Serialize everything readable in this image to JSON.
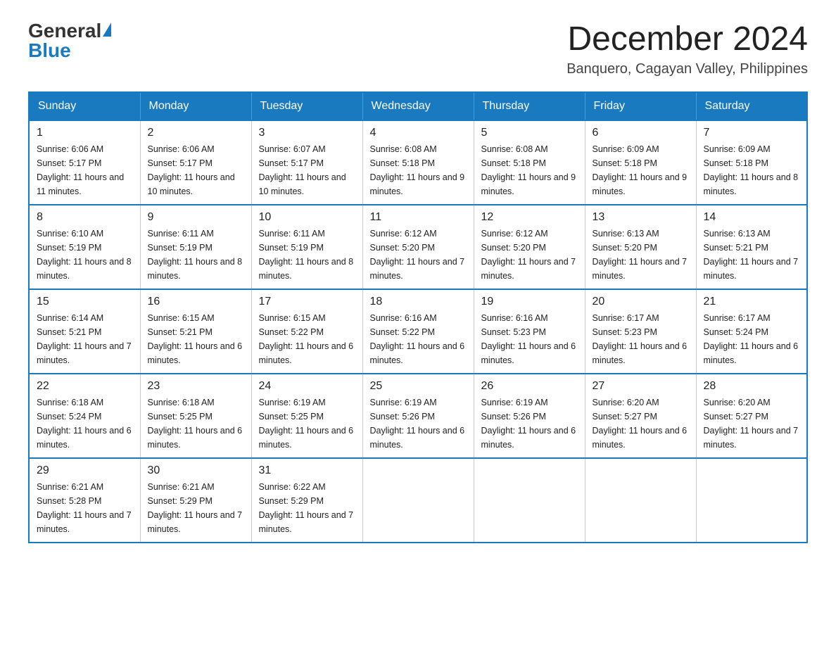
{
  "header": {
    "logo_general": "General",
    "logo_blue": "Blue",
    "month_title": "December 2024",
    "location": "Banquero, Cagayan Valley, Philippines"
  },
  "days_of_week": [
    "Sunday",
    "Monday",
    "Tuesday",
    "Wednesday",
    "Thursday",
    "Friday",
    "Saturday"
  ],
  "weeks": [
    [
      {
        "day": "1",
        "sunrise": "6:06 AM",
        "sunset": "5:17 PM",
        "daylight": "11 hours and 11 minutes."
      },
      {
        "day": "2",
        "sunrise": "6:06 AM",
        "sunset": "5:17 PM",
        "daylight": "11 hours and 10 minutes."
      },
      {
        "day": "3",
        "sunrise": "6:07 AM",
        "sunset": "5:17 PM",
        "daylight": "11 hours and 10 minutes."
      },
      {
        "day": "4",
        "sunrise": "6:08 AM",
        "sunset": "5:18 PM",
        "daylight": "11 hours and 9 minutes."
      },
      {
        "day": "5",
        "sunrise": "6:08 AM",
        "sunset": "5:18 PM",
        "daylight": "11 hours and 9 minutes."
      },
      {
        "day": "6",
        "sunrise": "6:09 AM",
        "sunset": "5:18 PM",
        "daylight": "11 hours and 9 minutes."
      },
      {
        "day": "7",
        "sunrise": "6:09 AM",
        "sunset": "5:18 PM",
        "daylight": "11 hours and 8 minutes."
      }
    ],
    [
      {
        "day": "8",
        "sunrise": "6:10 AM",
        "sunset": "5:19 PM",
        "daylight": "11 hours and 8 minutes."
      },
      {
        "day": "9",
        "sunrise": "6:11 AM",
        "sunset": "5:19 PM",
        "daylight": "11 hours and 8 minutes."
      },
      {
        "day": "10",
        "sunrise": "6:11 AM",
        "sunset": "5:19 PM",
        "daylight": "11 hours and 8 minutes."
      },
      {
        "day": "11",
        "sunrise": "6:12 AM",
        "sunset": "5:20 PM",
        "daylight": "11 hours and 7 minutes."
      },
      {
        "day": "12",
        "sunrise": "6:12 AM",
        "sunset": "5:20 PM",
        "daylight": "11 hours and 7 minutes."
      },
      {
        "day": "13",
        "sunrise": "6:13 AM",
        "sunset": "5:20 PM",
        "daylight": "11 hours and 7 minutes."
      },
      {
        "day": "14",
        "sunrise": "6:13 AM",
        "sunset": "5:21 PM",
        "daylight": "11 hours and 7 minutes."
      }
    ],
    [
      {
        "day": "15",
        "sunrise": "6:14 AM",
        "sunset": "5:21 PM",
        "daylight": "11 hours and 7 minutes."
      },
      {
        "day": "16",
        "sunrise": "6:15 AM",
        "sunset": "5:21 PM",
        "daylight": "11 hours and 6 minutes."
      },
      {
        "day": "17",
        "sunrise": "6:15 AM",
        "sunset": "5:22 PM",
        "daylight": "11 hours and 6 minutes."
      },
      {
        "day": "18",
        "sunrise": "6:16 AM",
        "sunset": "5:22 PM",
        "daylight": "11 hours and 6 minutes."
      },
      {
        "day": "19",
        "sunrise": "6:16 AM",
        "sunset": "5:23 PM",
        "daylight": "11 hours and 6 minutes."
      },
      {
        "day": "20",
        "sunrise": "6:17 AM",
        "sunset": "5:23 PM",
        "daylight": "11 hours and 6 minutes."
      },
      {
        "day": "21",
        "sunrise": "6:17 AM",
        "sunset": "5:24 PM",
        "daylight": "11 hours and 6 minutes."
      }
    ],
    [
      {
        "day": "22",
        "sunrise": "6:18 AM",
        "sunset": "5:24 PM",
        "daylight": "11 hours and 6 minutes."
      },
      {
        "day": "23",
        "sunrise": "6:18 AM",
        "sunset": "5:25 PM",
        "daylight": "11 hours and 6 minutes."
      },
      {
        "day": "24",
        "sunrise": "6:19 AM",
        "sunset": "5:25 PM",
        "daylight": "11 hours and 6 minutes."
      },
      {
        "day": "25",
        "sunrise": "6:19 AM",
        "sunset": "5:26 PM",
        "daylight": "11 hours and 6 minutes."
      },
      {
        "day": "26",
        "sunrise": "6:19 AM",
        "sunset": "5:26 PM",
        "daylight": "11 hours and 6 minutes."
      },
      {
        "day": "27",
        "sunrise": "6:20 AM",
        "sunset": "5:27 PM",
        "daylight": "11 hours and 6 minutes."
      },
      {
        "day": "28",
        "sunrise": "6:20 AM",
        "sunset": "5:27 PM",
        "daylight": "11 hours and 7 minutes."
      }
    ],
    [
      {
        "day": "29",
        "sunrise": "6:21 AM",
        "sunset": "5:28 PM",
        "daylight": "11 hours and 7 minutes."
      },
      {
        "day": "30",
        "sunrise": "6:21 AM",
        "sunset": "5:29 PM",
        "daylight": "11 hours and 7 minutes."
      },
      {
        "day": "31",
        "sunrise": "6:22 AM",
        "sunset": "5:29 PM",
        "daylight": "11 hours and 7 minutes."
      },
      {
        "day": "",
        "sunrise": "",
        "sunset": "",
        "daylight": ""
      },
      {
        "day": "",
        "sunrise": "",
        "sunset": "",
        "daylight": ""
      },
      {
        "day": "",
        "sunrise": "",
        "sunset": "",
        "daylight": ""
      },
      {
        "day": "",
        "sunrise": "",
        "sunset": "",
        "daylight": ""
      }
    ]
  ],
  "labels": {
    "sunrise_prefix": "Sunrise: ",
    "sunset_prefix": "Sunset: ",
    "daylight_prefix": "Daylight: "
  }
}
